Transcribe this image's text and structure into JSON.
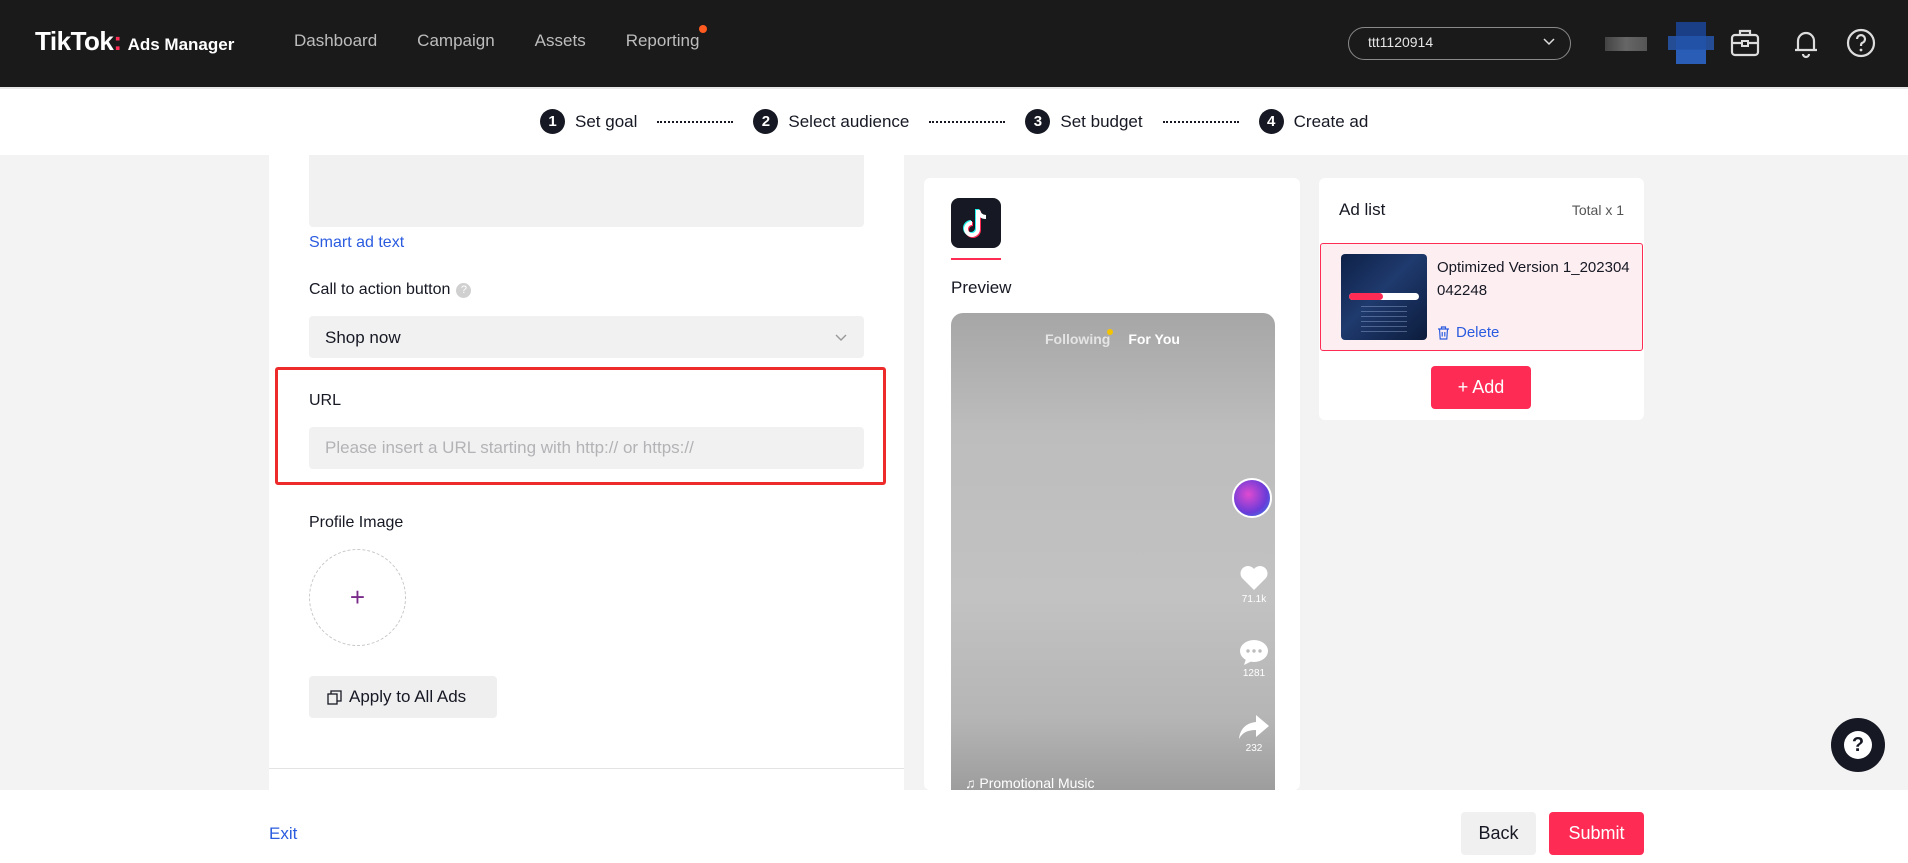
{
  "header": {
    "brand": "TikTok",
    "brand_sub": "Ads Manager",
    "nav": [
      "Dashboard",
      "Campaign",
      "Assets",
      "Reporting"
    ],
    "account": "ttt1120914"
  },
  "steps": [
    {
      "num": "1",
      "label": "Set goal"
    },
    {
      "num": "2",
      "label": "Select audience"
    },
    {
      "num": "3",
      "label": "Set budget"
    },
    {
      "num": "4",
      "label": "Create ad"
    }
  ],
  "form": {
    "smart_ad_text": "Smart ad text",
    "cta_label": "Call to action button",
    "cta_value": "Shop now",
    "url_label": "URL",
    "url_placeholder": "Please insert a URL starting with http:// or https://",
    "profile_label": "Profile Image",
    "apply_label": "Apply to All Ads"
  },
  "preview": {
    "title": "Preview",
    "tab_following": "Following",
    "tab_foryou": "For You",
    "likes": "71.1k",
    "comments": "1281",
    "shares": "232",
    "music": "Promotional Music"
  },
  "adlist": {
    "title": "Ad list",
    "total": "Total x 1",
    "item_name": "Optimized Version 1_202304042248",
    "delete_label": "Delete",
    "add_label": "Add"
  },
  "footer": {
    "exit": "Exit",
    "back": "Back",
    "submit": "Submit"
  },
  "colors": {
    "accent": "#fe2c55",
    "link": "#2b5ce0",
    "topbar": "#1a1a1a",
    "highlight": "#ee2b2b"
  }
}
